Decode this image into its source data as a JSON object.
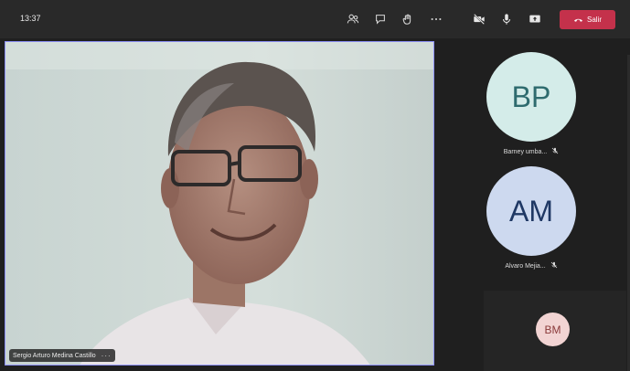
{
  "topbar": {
    "time": "13:37",
    "icons": [
      "people-icon",
      "chat-icon",
      "raise-hand-icon",
      "more-icon",
      "camera-off-icon",
      "microphone-icon",
      "share-icon"
    ],
    "leave_label": "Salir",
    "leave_color": "#c4314b"
  },
  "main": {
    "participant_name": "Sergio Arturo Medina Castillo",
    "more_label": "···",
    "border_color": "#8c8ff5"
  },
  "participants": [
    {
      "initials": "BP",
      "name": "Barney umba...",
      "avatar_bg": "#d4ece9",
      "avatar_fg": "#2e6b6e"
    },
    {
      "initials": "AM",
      "name": "Alvaro Mejia...",
      "avatar_bg": "#cdd9ef",
      "avatar_fg": "#1f3864"
    },
    {
      "initials": "BM",
      "avatar_bg": "#f2d4d3",
      "avatar_fg": "#8a3a3a"
    }
  ]
}
